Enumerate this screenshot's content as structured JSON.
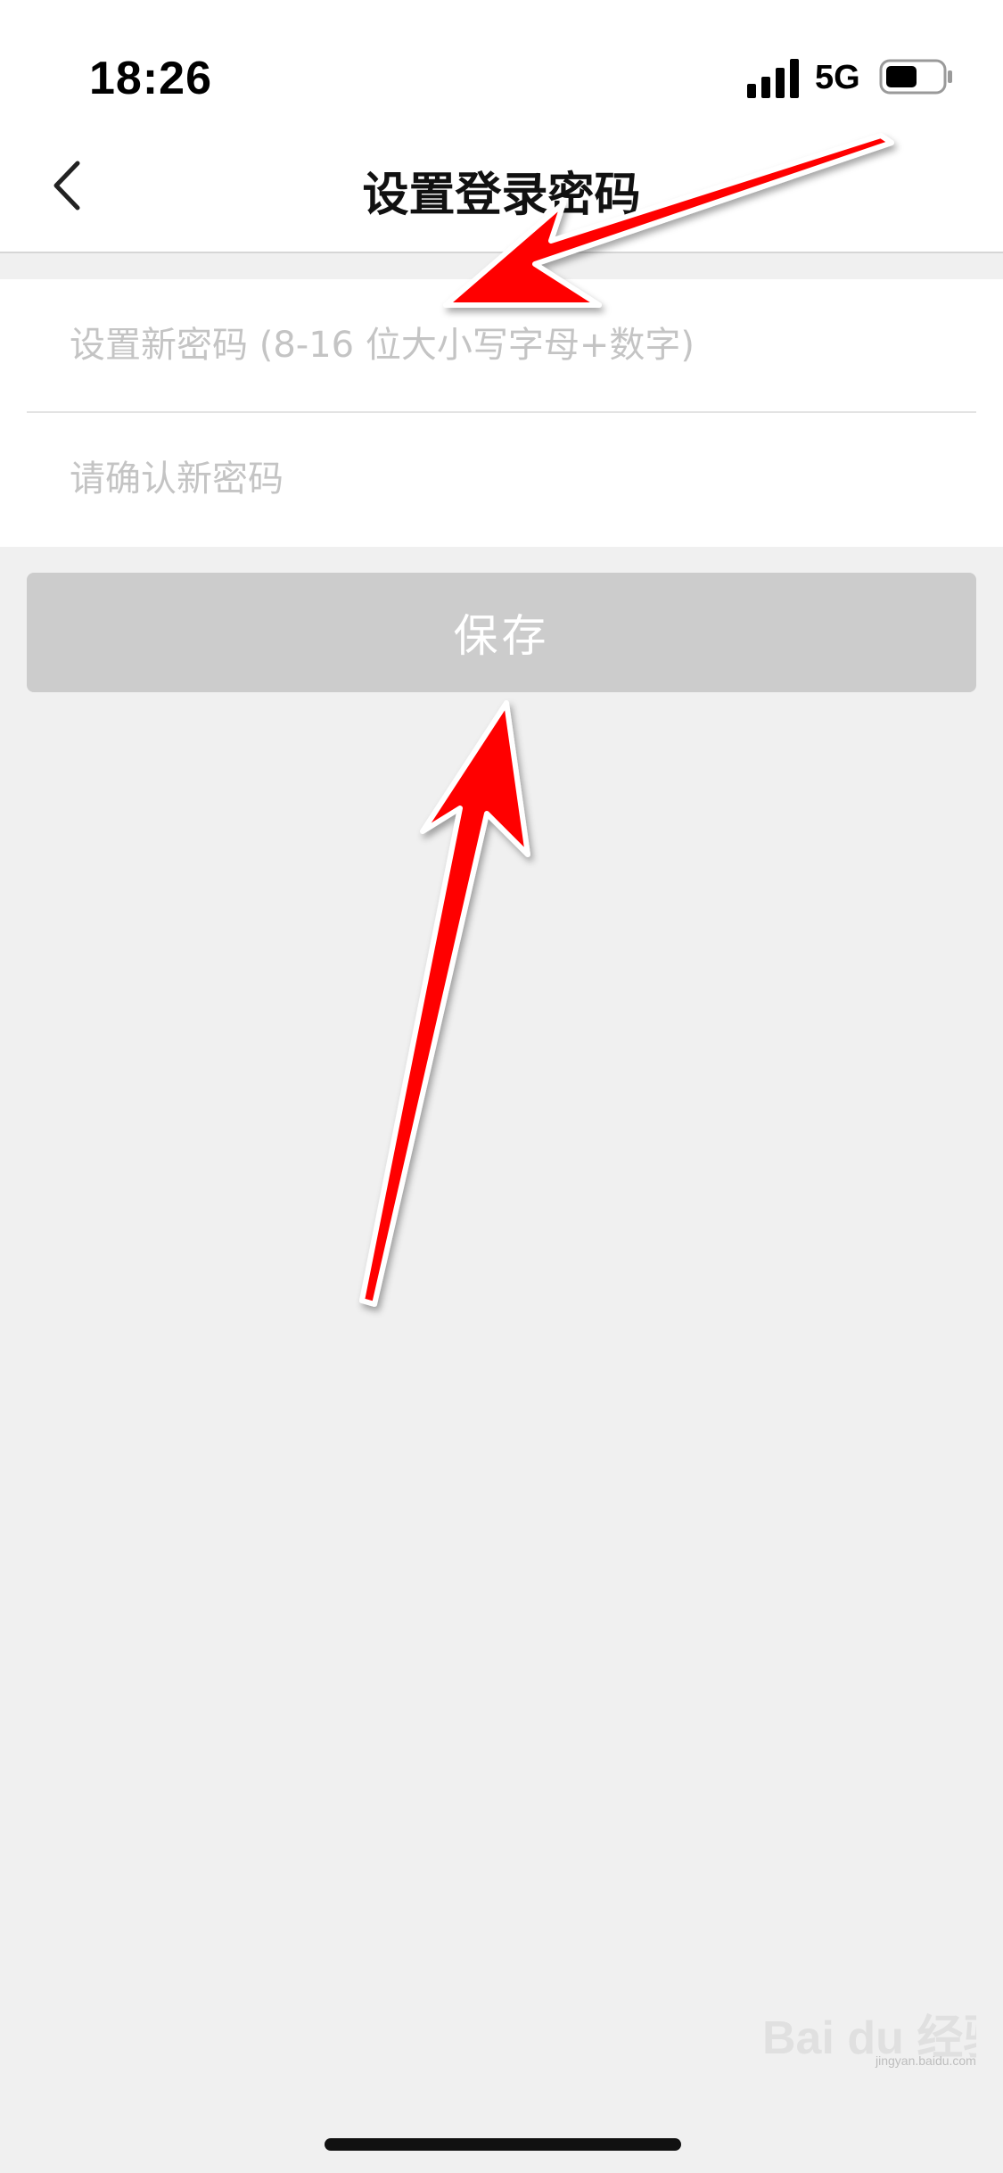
{
  "status_bar": {
    "time": "18:26",
    "network": "5G",
    "icons": [
      "signal-icon",
      "battery-icon"
    ]
  },
  "nav": {
    "title": "设置登录密码",
    "back_icon": "chevron-left-icon"
  },
  "form": {
    "new_password_placeholder": "设置新密码 (8-16 位大小写字母+数字)",
    "confirm_password_placeholder": "请确认新密码",
    "new_password_value": "",
    "confirm_password_value": ""
  },
  "actions": {
    "save_label": "保存"
  },
  "annotations": {
    "arrow_color": "#ff0000",
    "count": 2
  },
  "watermark": {
    "brand": "Bai du 经验",
    "site": "jingyan.baidu.com"
  },
  "colors": {
    "background": "#f0f0f0",
    "surface": "#ffffff",
    "button_disabled": "#cccccc",
    "placeholder": "#c4c4c4"
  }
}
